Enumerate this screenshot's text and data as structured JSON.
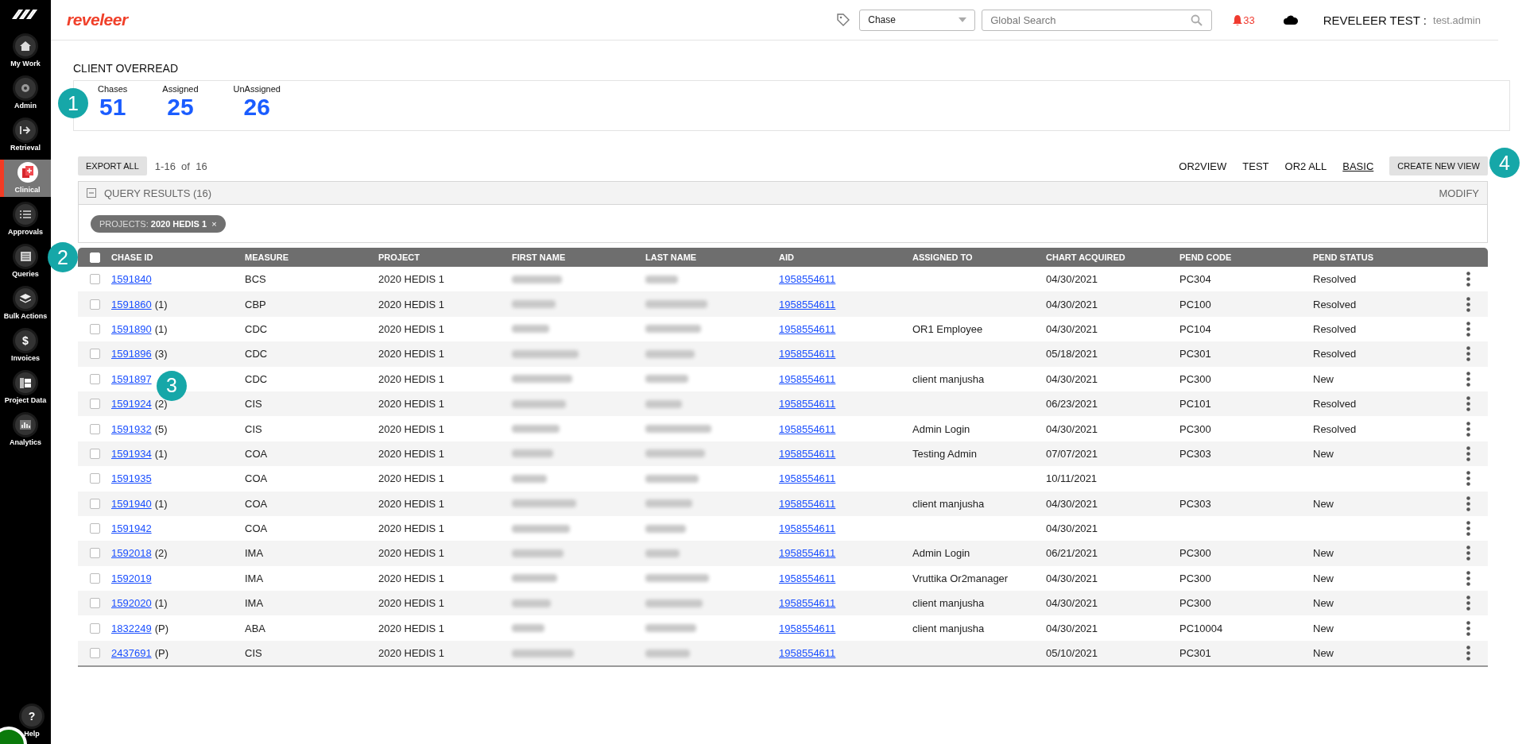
{
  "sidebar": {
    "items": [
      {
        "label": "My Work",
        "selected": false
      },
      {
        "label": "Admin",
        "selected": false
      },
      {
        "label": "Retrieval",
        "selected": false
      },
      {
        "label": "Clinical",
        "selected": true
      },
      {
        "label": "Approvals",
        "selected": false
      },
      {
        "label": "Queries",
        "selected": false
      },
      {
        "label": "Bulk Actions",
        "selected": false
      },
      {
        "label": "Invoices",
        "selected": false
      },
      {
        "label": "Project Data",
        "selected": false
      },
      {
        "label": "Analytics",
        "selected": false
      }
    ],
    "help": {
      "label": "Help",
      "glyph": "?"
    },
    "invoice_glyph": "$"
  },
  "header": {
    "logo": "reveleer",
    "type_select": "Chase",
    "search": {
      "placeholder": "Global Search"
    },
    "alerts": "33",
    "user": {
      "org": "REVELEER TEST :",
      "name": "test.admin"
    }
  },
  "page_title": "CLIENT OVERREAD",
  "summary": {
    "marker": "1",
    "stats": [
      {
        "label": "Chases",
        "value": "51"
      },
      {
        "label": "Assigned",
        "value": "25"
      },
      {
        "label": "UnAssigned",
        "value": "26"
      }
    ]
  },
  "toolbar": {
    "export": "EXPORT ALL",
    "range": "1-16  of  16",
    "views": [
      {
        "label": "OR2VIEW",
        "selected": false
      },
      {
        "label": "TEST",
        "selected": false
      },
      {
        "label": "OR2 ALL",
        "selected": false
      },
      {
        "label": "BASIC",
        "selected": true
      }
    ],
    "create": "CREATE NEW VIEW",
    "create_marker": "4"
  },
  "query": {
    "title": "QUERY RESULTS (16)",
    "expanded": true,
    "modify": "MODIFY",
    "filters": [
      {
        "label": "PROJECTS:",
        "value": "2020 HEDIS 1",
        "remove": "×"
      }
    ]
  },
  "table": {
    "marker": "2",
    "all_checked": false,
    "columns": [
      "CHASE ID",
      "MEASURE",
      "PROJECT",
      "FIRST NAME",
      "LAST NAME",
      "AID",
      "ASSIGNED TO",
      "CHART ACQUIRED",
      "PEND CODE",
      "PEND STATUS"
    ],
    "rows": [
      {
        "chase_id": "1591840",
        "note": "",
        "measure": "BCS",
        "project": "2020 HEDIS 1",
        "aid": "1958554611",
        "assigned_to": "",
        "chart_acquired": "04/30/2021",
        "pend_code": "PC304",
        "pend_status": "Resolved",
        "checked": false
      },
      {
        "chase_id": "1591860",
        "note": "(1)",
        "measure": "CBP",
        "project": "2020 HEDIS 1",
        "aid": "1958554611",
        "assigned_to": "",
        "chart_acquired": "04/30/2021",
        "pend_code": "PC100",
        "pend_status": "Resolved",
        "checked": false
      },
      {
        "chase_id": "1591890",
        "note": "(1)",
        "measure": "CDC",
        "project": "2020 HEDIS 1",
        "aid": "1958554611",
        "assigned_to": "OR1 Employee",
        "chart_acquired": "04/30/2021",
        "pend_code": "PC104",
        "pend_status": "Resolved",
        "checked": false
      },
      {
        "chase_id": "1591896",
        "note": "(3)",
        "measure": "CDC",
        "project": "2020 HEDIS 1",
        "aid": "1958554611",
        "assigned_to": "",
        "chart_acquired": "05/18/2021",
        "pend_code": "PC301",
        "pend_status": "Resolved",
        "checked": false
      },
      {
        "chase_id": "1591897",
        "note": "",
        "marker": "3",
        "measure": "CDC",
        "project": "2020 HEDIS 1",
        "aid": "1958554611",
        "assigned_to": "client manjusha",
        "chart_acquired": "04/30/2021",
        "pend_code": "PC300",
        "pend_status": "New",
        "checked": false
      },
      {
        "chase_id": "1591924",
        "note": "(2)",
        "measure": "CIS",
        "project": "2020 HEDIS 1",
        "aid": "1958554611",
        "assigned_to": "",
        "chart_acquired": "06/23/2021",
        "pend_code": "PC101",
        "pend_status": "Resolved",
        "checked": false
      },
      {
        "chase_id": "1591932",
        "note": "(5)",
        "measure": "CIS",
        "project": "2020 HEDIS 1",
        "aid": "1958554611",
        "assigned_to": "Admin Login",
        "chart_acquired": "04/30/2021",
        "pend_code": "PC300",
        "pend_status": "Resolved",
        "checked": false
      },
      {
        "chase_id": "1591934",
        "note": "(1)",
        "measure": "COA",
        "project": "2020 HEDIS 1",
        "aid": "1958554611",
        "assigned_to": "Testing Admin",
        "chart_acquired": "07/07/2021",
        "pend_code": "PC303",
        "pend_status": "New",
        "checked": false
      },
      {
        "chase_id": "1591935",
        "note": "",
        "measure": "COA",
        "project": "2020 HEDIS 1",
        "aid": "1958554611",
        "assigned_to": "",
        "chart_acquired": "10/11/2021",
        "pend_code": "",
        "pend_status": "",
        "checked": false
      },
      {
        "chase_id": "1591940",
        "note": "(1)",
        "measure": "COA",
        "project": "2020 HEDIS 1",
        "aid": "1958554611",
        "assigned_to": "client manjusha",
        "chart_acquired": "04/30/2021",
        "pend_code": "PC303",
        "pend_status": "New",
        "checked": false
      },
      {
        "chase_id": "1591942",
        "note": "",
        "measure": "COA",
        "project": "2020 HEDIS 1",
        "aid": "1958554611",
        "assigned_to": "",
        "chart_acquired": "04/30/2021",
        "pend_code": "",
        "pend_status": "",
        "checked": false
      },
      {
        "chase_id": "1592018",
        "note": "(2)",
        "measure": "IMA",
        "project": "2020 HEDIS 1",
        "aid": "1958554611",
        "assigned_to": "Admin Login",
        "chart_acquired": "06/21/2021",
        "pend_code": "PC300",
        "pend_status": "New",
        "checked": false
      },
      {
        "chase_id": "1592019",
        "note": "",
        "measure": "IMA",
        "project": "2020 HEDIS 1",
        "aid": "1958554611",
        "assigned_to": "Vruttika Or2manager",
        "chart_acquired": "04/30/2021",
        "pend_code": "PC300",
        "pend_status": "New",
        "checked": false
      },
      {
        "chase_id": "1592020",
        "note": "(1)",
        "measure": "IMA",
        "project": "2020 HEDIS 1",
        "aid": "1958554611",
        "assigned_to": "client manjusha",
        "chart_acquired": "04/30/2021",
        "pend_code": "PC300",
        "pend_status": "New",
        "checked": false
      },
      {
        "chase_id": "1832249",
        "note": "(P)",
        "measure": "ABA",
        "project": "2020 HEDIS 1",
        "aid": "1958554611",
        "assigned_to": "client manjusha",
        "chart_acquired": "04/30/2021",
        "pend_code": "PC10004",
        "pend_status": "New",
        "checked": false
      },
      {
        "chase_id": "2437691",
        "note": "(P)",
        "measure": "CIS",
        "project": "2020 HEDIS 1",
        "aid": "1958554611",
        "assigned_to": "",
        "chart_acquired": "05/10/2021",
        "pend_code": "PC301",
        "pend_status": "New",
        "checked": false
      }
    ]
  }
}
